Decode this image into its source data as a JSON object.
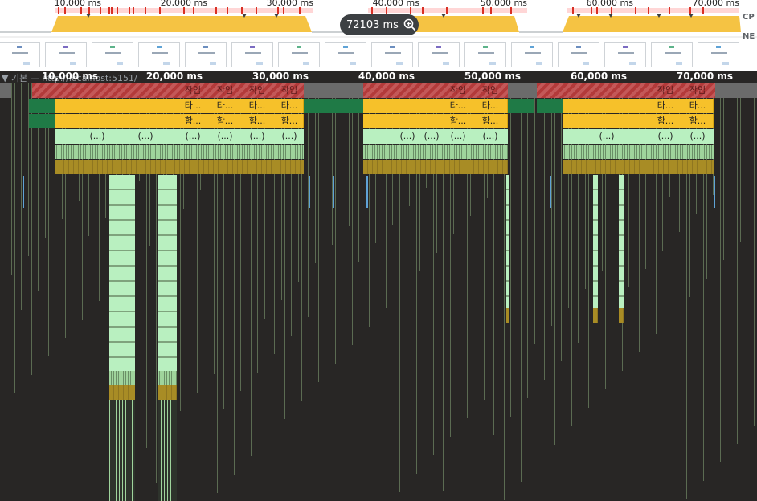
{
  "overview": {
    "ruler_ticks": [
      "10,000 ms",
      "20,000 ms",
      "30,000 ms",
      "40,000 ms",
      "50,000 ms",
      "60,000 ms",
      "70,000 ms"
    ],
    "side_labels": [
      "CP",
      "NE"
    ],
    "zoom_badge": "72103 ms",
    "zoom_icon": "zoom-in-icon"
  },
  "track": {
    "title": "▼ 기본 — http://localhost:5151/",
    "ticks": [
      "10,000 ms",
      "20,000 ms",
      "30,000 ms",
      "40,000 ms",
      "50,000 ms",
      "60,000 ms",
      "70,000 ms"
    ]
  },
  "flame": {
    "task_label": "작업",
    "timer_label": "타...",
    "func_label": "함...",
    "anon_label": "(...)"
  },
  "colors": {
    "background": "#282625",
    "task": "#c13b3b",
    "scripting": "#f6c12a",
    "system": "#1f7a46",
    "anon": "#b9f0c0",
    "stripe": "#9fd49c",
    "olive": "#a88c25",
    "cpu_fill": "#f5c343",
    "selection": "#ffd6d6"
  }
}
